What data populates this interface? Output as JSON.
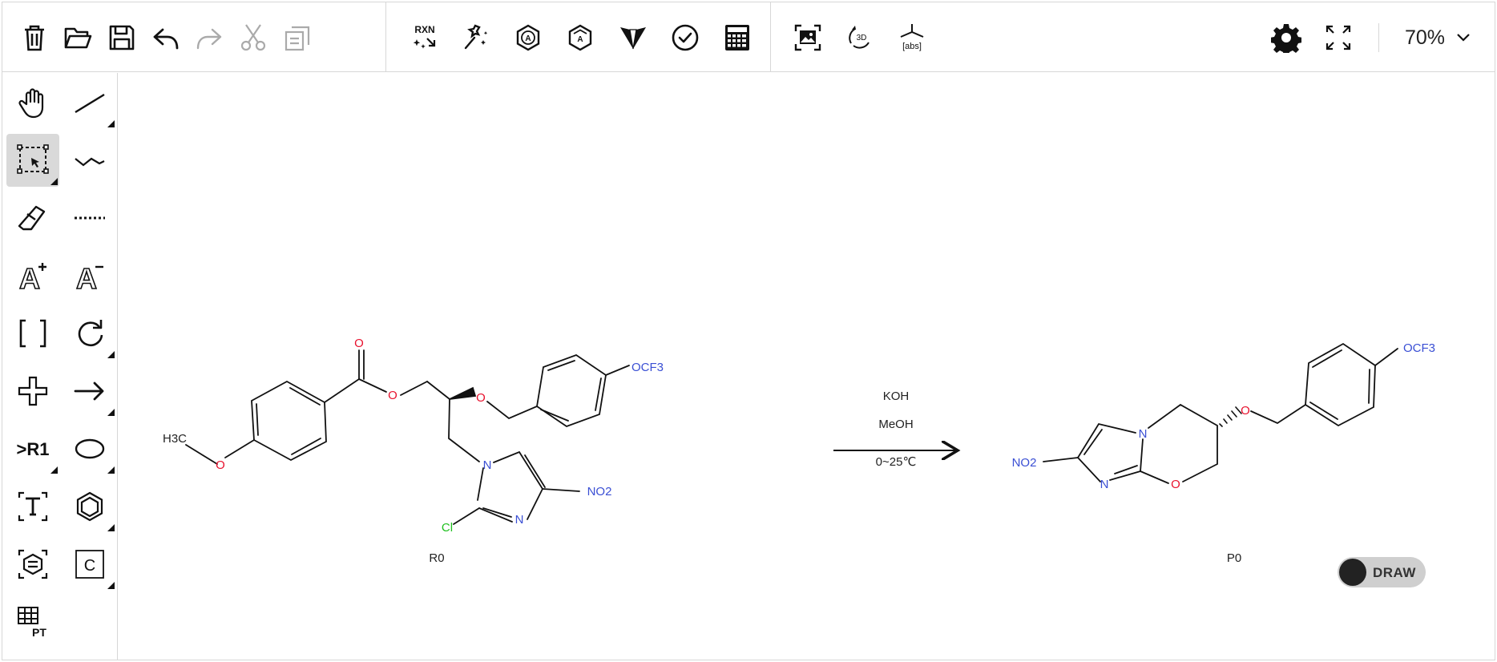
{
  "toolbar": {
    "buttons": [
      {
        "name": "clear-canvas",
        "icon": "trash-icon"
      },
      {
        "name": "open-file",
        "icon": "folder-open-icon"
      },
      {
        "name": "save-file",
        "icon": "save-icon"
      },
      {
        "name": "undo",
        "icon": "undo-icon"
      },
      {
        "name": "redo",
        "icon": "redo-icon"
      },
      {
        "name": "cut",
        "icon": "scissors-icon"
      },
      {
        "name": "copy",
        "icon": "copy-icon"
      },
      {
        "name": "reaction-auto-map",
        "icon": "rxn-auto-map-icon",
        "label": "RXN"
      },
      {
        "name": "clean-up",
        "icon": "magic-wand-icon"
      },
      {
        "name": "aromatize",
        "icon": "aromatize-icon",
        "label": "A"
      },
      {
        "name": "dearomatize",
        "icon": "dearomatize-icon",
        "label": "A"
      },
      {
        "name": "calculate-cip",
        "icon": "cip-icon"
      },
      {
        "name": "check-structure",
        "icon": "check-circle-icon"
      },
      {
        "name": "calculated-values",
        "icon": "calculator-icon"
      },
      {
        "name": "recognize-image",
        "icon": "image-recognize-icon"
      },
      {
        "name": "3d-viewer",
        "icon": "3d-rotate-icon",
        "label": "3D"
      },
      {
        "name": "stereo-abs",
        "icon": "abs-stereo-icon",
        "label": "[abs]"
      },
      {
        "name": "settings",
        "icon": "gear-icon"
      },
      {
        "name": "fullscreen",
        "icon": "fullscreen-icon"
      }
    ],
    "zoom": "70%"
  },
  "left_tools": [
    {
      "name": "hand-tool",
      "icon": "hand-icon"
    },
    {
      "name": "single-bond",
      "icon": "single-bond-icon"
    },
    {
      "name": "rectangle-select",
      "icon": "rectangle-select-icon",
      "active": true
    },
    {
      "name": "any-bond",
      "icon": "wavy-bond-icon"
    },
    {
      "name": "eraser",
      "icon": "eraser-icon"
    },
    {
      "name": "dotted-bond",
      "icon": "dotted-bond-icon"
    },
    {
      "name": "charge-plus",
      "icon": "charge-plus-icon",
      "label": "A+"
    },
    {
      "name": "charge-minus",
      "icon": "charge-minus-icon",
      "label": "A−"
    },
    {
      "name": "sgroup-bracket",
      "icon": "brackets-icon"
    },
    {
      "name": "rotate",
      "icon": "rotate-icon"
    },
    {
      "name": "reaction-plus",
      "icon": "plus-icon"
    },
    {
      "name": "reaction-arrow",
      "icon": "arrow-right-icon"
    },
    {
      "name": "r-group",
      "icon": "r-group-icon",
      "label": ">R1"
    },
    {
      "name": "shape-ellipse",
      "icon": "ellipse-icon"
    },
    {
      "name": "text-tool",
      "icon": "text-icon",
      "label": "T"
    },
    {
      "name": "benzene-template",
      "icon": "benzene-icon"
    },
    {
      "name": "template-library",
      "icon": "template-library-icon"
    },
    {
      "name": "carbon-atom",
      "icon": "atom-c-icon",
      "label": "C"
    },
    {
      "name": "periodic-table",
      "icon": "periodic-table-icon",
      "label": "PT"
    }
  ],
  "reaction": {
    "reactant_label": "R0",
    "product_label": "P0",
    "conditions": [
      "KOH",
      "MeOH",
      "0~25℃"
    ],
    "reactant_atoms": {
      "o_carbonyl": "O",
      "o_ester": "O",
      "o_ether": "O",
      "o_methoxy": "O",
      "methyl": "H3C",
      "ocf3": "OCF3",
      "n1": "N",
      "n3": "N",
      "no2": "NO2",
      "cl": "Cl"
    },
    "product_atoms": {
      "ocf3": "OCF3",
      "o_ether": "O",
      "n_bridge": "N",
      "n_ring": "N",
      "o_ring": "O",
      "no2": "NO2"
    }
  },
  "draw_toggle": {
    "label": "DRAW",
    "state": "off"
  },
  "colors": {
    "oxygen": "#e8112d",
    "nitrogen": "#3050f8",
    "chlorine": "#1ff01f",
    "heteroatom_blue": "#3a4fd4",
    "active_tool": "#d9d9d9",
    "border": "#d7d7d7"
  }
}
